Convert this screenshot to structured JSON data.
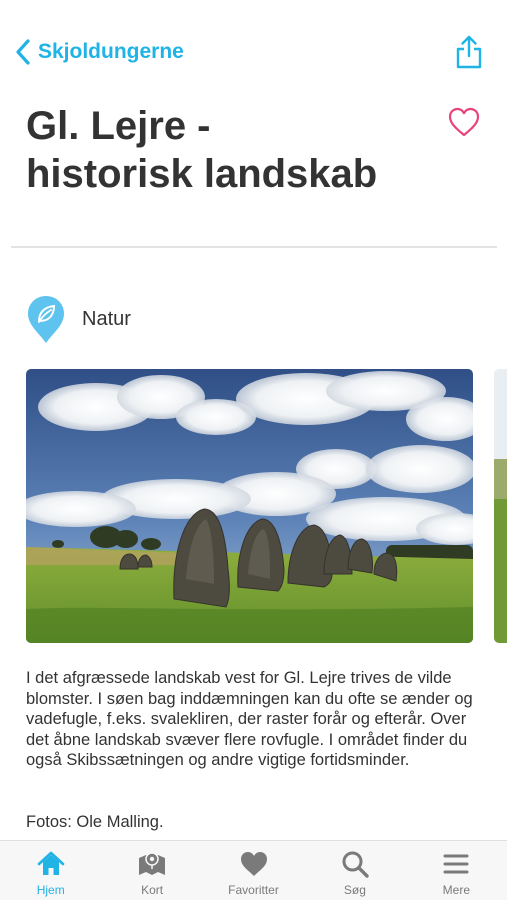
{
  "nav": {
    "back_label": "Skjoldungerne"
  },
  "page": {
    "title_line1": "Gl. Lejre -",
    "title_line2": "historisk landskab"
  },
  "category": {
    "label": "Natur"
  },
  "content": {
    "description": "I det afgræssede landskab vest for Gl. Lejre trives de vilde blomster. I søen bag inddæmningen kan du ofte se ænder og vadefugle, f.eks. svalekliren, der raster forår og efterår. Over det åbne landskab svæver flere rovfugle. I området finder du også Skibssætningen og andre vigtige fortidsminder.",
    "credit": "Fotos: Ole Malling."
  },
  "tabs": [
    {
      "label": "Hjem",
      "icon": "home-icon",
      "active": true
    },
    {
      "label": "Kort",
      "icon": "map-icon",
      "active": false
    },
    {
      "label": "Favoritter",
      "icon": "heart-icon",
      "active": false
    },
    {
      "label": "Søg",
      "icon": "search-icon",
      "active": false
    },
    {
      "label": "Mere",
      "icon": "menu-icon",
      "active": false
    }
  ],
  "colors": {
    "accent": "#1fb3e6",
    "favorite": "#e8437a",
    "category_pin": "#5ec3ee",
    "text": "#333333",
    "tab_inactive": "#7a7a7a"
  }
}
